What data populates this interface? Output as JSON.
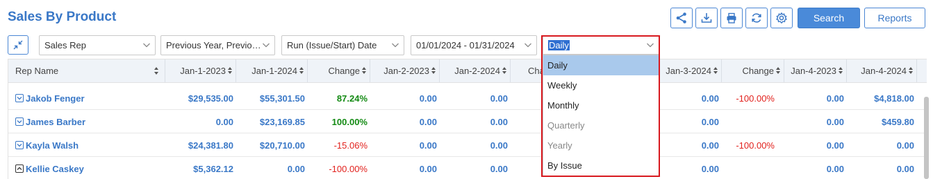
{
  "page": {
    "title": "Sales By Product"
  },
  "toolbar": {
    "icons": [
      "share-icon",
      "download-icon",
      "print-icon",
      "refresh-icon",
      "settings-icon"
    ],
    "search_label": "Search",
    "reports_label": "Reports"
  },
  "filters": {
    "group_by": "Sales Rep",
    "compare": "Previous Year, Previous ...",
    "date_type": "Run (Issue/Start) Date",
    "date_range": "01/01/2024 - 01/31/2024",
    "period": "Daily"
  },
  "period_dropdown": {
    "options": [
      {
        "label": "Daily",
        "state": "selected"
      },
      {
        "label": "Weekly",
        "state": "enabled"
      },
      {
        "label": "Monthly",
        "state": "enabled"
      },
      {
        "label": "Quarterly",
        "state": "disabled"
      },
      {
        "label": "Yearly",
        "state": "disabled"
      },
      {
        "label": "By Issue",
        "state": "enabled"
      }
    ]
  },
  "table": {
    "columns": [
      "Rep Name",
      "Jan-1-2023",
      "Jan-1-2024",
      "Change",
      "Jan-2-2023",
      "Jan-2-2024",
      "Cha",
      "",
      "Jan-3-2024",
      "Change",
      "Jan-4-2023",
      "Jan-4-2024"
    ],
    "rows": [
      {
        "name": "Jakob Fenger",
        "expand": "collapsed",
        "cells": [
          "$29,535.00",
          "$55,301.50",
          "87.24%",
          "0.00",
          "0.00",
          "0.00",
          "-100.00%",
          "0.00",
          "$4,818.00"
        ],
        "change_colors": [
          "green",
          "",
          "red"
        ]
      },
      {
        "name": "James Barber",
        "expand": "collapsed",
        "cells": [
          "0.00",
          "$23,169.85",
          "100.00%",
          "0.00",
          "0.00",
          "0.00",
          "",
          "0.00",
          "$459.80"
        ],
        "change_colors": [
          "green",
          "",
          ""
        ]
      },
      {
        "name": "Kayla Walsh",
        "expand": "collapsed",
        "cells": [
          "$24,381.80",
          "$20,710.00",
          "-15.06%",
          "0.00",
          "0.00",
          "0.00",
          "-100.00%",
          "0.00",
          "0.00"
        ],
        "change_colors": [
          "red",
          "",
          "red"
        ]
      },
      {
        "name": "Kellie Caskey",
        "expand": "expanded",
        "cells": [
          "$5,362.12",
          "0.00",
          "-100.00%",
          "0.00",
          "0.00",
          "0.00",
          "",
          "0.00",
          "0.00"
        ],
        "change_colors": [
          "red",
          "",
          ""
        ]
      }
    ]
  }
}
